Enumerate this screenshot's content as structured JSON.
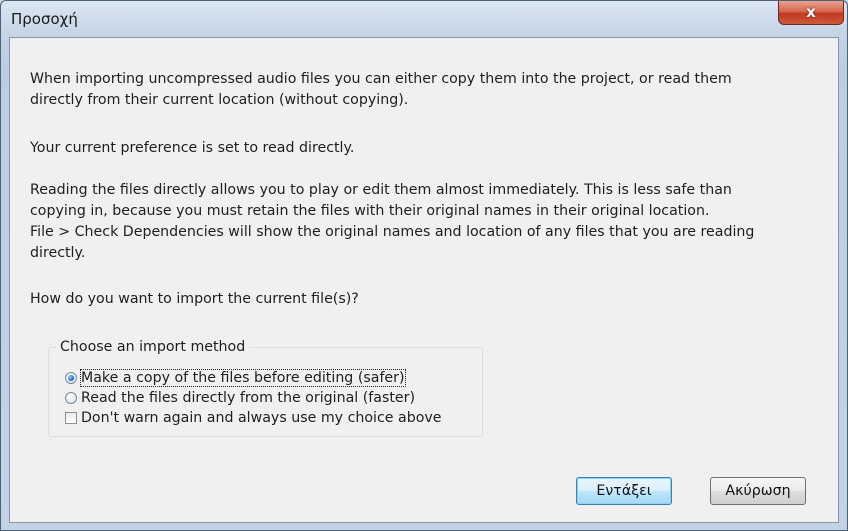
{
  "window": {
    "title": "Προσοχή",
    "close_label": "x"
  },
  "message": {
    "paragraph1_line1": "When importing uncompressed audio files you can either copy them into the project, or read them",
    "paragraph1_line2": "directly from their current location (without copying).",
    "paragraph2": "Your current preference is set to read directly.",
    "paragraph3_line1": "Reading the files directly allows you to play or edit them almost immediately.  This is less safe than",
    "paragraph3_line2": "copying in, because you must retain the files with their original names in their original location.",
    "paragraph3_line3": "File > Check Dependencies will show the original names and location of any files that you are reading",
    "paragraph3_line4": "directly.",
    "question": "How do you want to import the current file(s)?"
  },
  "import_group": {
    "title": "Choose an import method",
    "options": [
      {
        "label": "Make a copy of the files before editing (safer)",
        "checked": true
      },
      {
        "label": "Read the files directly from the original (faster)",
        "checked": false
      }
    ],
    "dont_warn_label": "Don't warn again and always use my choice above",
    "dont_warn_checked": false
  },
  "buttons": {
    "ok_label": "Εντάξει",
    "cancel_label": "Ακύρωση"
  }
}
